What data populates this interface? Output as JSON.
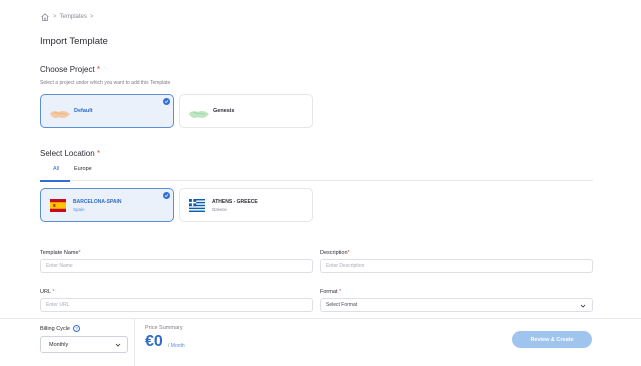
{
  "breadcrumb": {
    "home_icon": "home-icon",
    "separator": ">",
    "current": "Templates"
  },
  "page_title": "Import Template",
  "choose_project": {
    "title": "Choose Project",
    "required_marker": "*",
    "subtitle": "Select a project under which you want to add this Template",
    "projects": [
      {
        "name": "Default",
        "selected": true
      },
      {
        "name": "Genesis",
        "selected": false
      }
    ]
  },
  "select_location": {
    "title": "Select Location",
    "required_marker": "*",
    "tabs": [
      "All",
      "Europe"
    ],
    "active_tab": "All",
    "locations": [
      {
        "name": "BARCELONA-SPAIN",
        "country": "Spain",
        "selected": true,
        "flag": "spain-flag"
      },
      {
        "name": "ATHENS - GREECE",
        "country": "Greece",
        "selected": false,
        "flag": "greece-flag"
      }
    ]
  },
  "form": {
    "template_name": {
      "label": "Template Name",
      "required_marker": "*",
      "placeholder": "Enter Name"
    },
    "description": {
      "label": "Description",
      "required_marker": "*",
      "placeholder": "Enter Description"
    },
    "url": {
      "label": "URL",
      "required_marker": "*",
      "placeholder": "Enter URL"
    },
    "format": {
      "label": "Format",
      "required_marker": "*",
      "placeholder": "Select Format"
    }
  },
  "footer": {
    "billing_cycle_label": "Billing Cycle",
    "help_icon": "?",
    "billing_cycle_value": "Monthly",
    "price_summary_label": "Price Summary",
    "price_amount": "€0",
    "price_unit": "/ Month",
    "review_button": "Review & Create"
  },
  "colors": {
    "accent": "#2f6fd6",
    "button_disabled": "#9fc4ee",
    "required": "#e4474b"
  }
}
